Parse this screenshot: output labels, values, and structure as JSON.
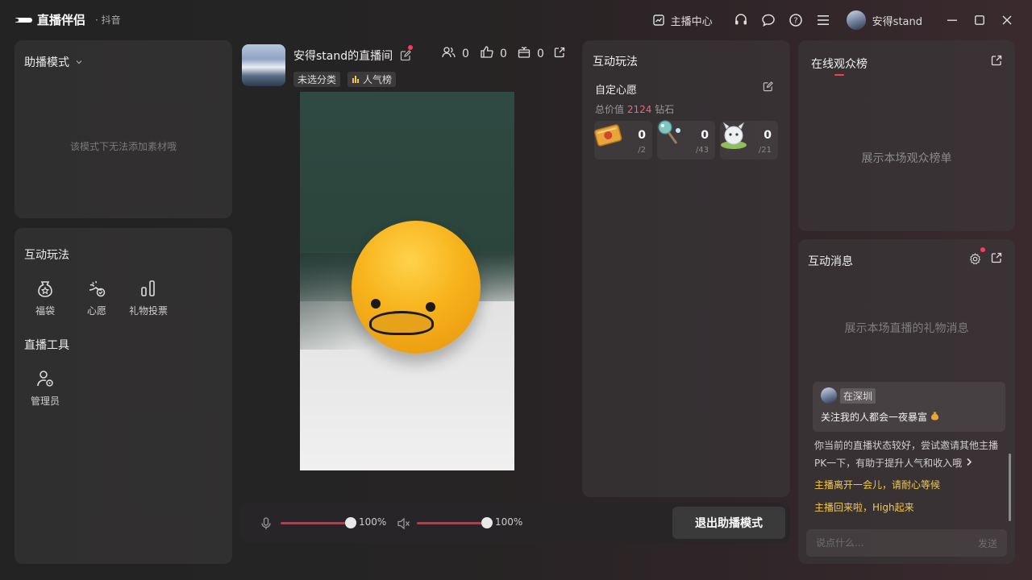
{
  "app": {
    "name": "直播伴侣",
    "platform": "抖音"
  },
  "titlebar": {
    "anchor_center": "主播中心",
    "username": "安得stand"
  },
  "left": {
    "mode_title": "助播模式",
    "mode_empty": "该模式下无法添加素材哦",
    "interactive_title": "互动玩法",
    "tools": [
      {
        "label": "福袋",
        "icon": "lucky-bag-icon"
      },
      {
        "label": "心愿",
        "icon": "wish-icon"
      },
      {
        "label": "礼物投票",
        "icon": "vote-chart-icon"
      }
    ],
    "live_tools_title": "直播工具",
    "live_tools": [
      {
        "label": "管理员",
        "icon": "admin-icon"
      }
    ]
  },
  "room": {
    "name": "安得stand的直播间",
    "category": "未选分类",
    "popularity": "人气榜",
    "viewers": "0",
    "likes": "0",
    "gifts": "0"
  },
  "controls": {
    "mic_percent": "100%",
    "speaker_percent": "100%",
    "mic_level": 1.0,
    "speaker_level": 1.0,
    "exit_label": "退出助播模式"
  },
  "games": {
    "title": "互动玩法",
    "wish_title": "自定心愿",
    "total_prefix": "总价值",
    "total_value": "2124",
    "total_suffix": "钻石",
    "gifts": [
      {
        "count": "0",
        "target": "/2"
      },
      {
        "count": "0",
        "target": "/43"
      },
      {
        "count": "0",
        "target": "/21"
      }
    ]
  },
  "audience": {
    "title": "在线观众榜",
    "empty": "展示本场观众榜单"
  },
  "messages": {
    "title": "互动消息",
    "empty": "展示本场直播的礼物消息",
    "location": "在深圳",
    "announcement": "关注我的人都会一夜暴富",
    "tip": "你当前的直播状态较好，尝试邀请其他主播PK一下，有助于提升人气和收入哦",
    "notice1": "主播离开一会儿，请耐心等候",
    "notice2": "主播回来啦，High起来",
    "input_placeholder": "说点什么...",
    "send_label": "发送"
  },
  "colors": {
    "accent_red": "#ff3b5c",
    "notice_yellow": "#f2c94c",
    "diamond_pink": "#ff5c7a"
  }
}
